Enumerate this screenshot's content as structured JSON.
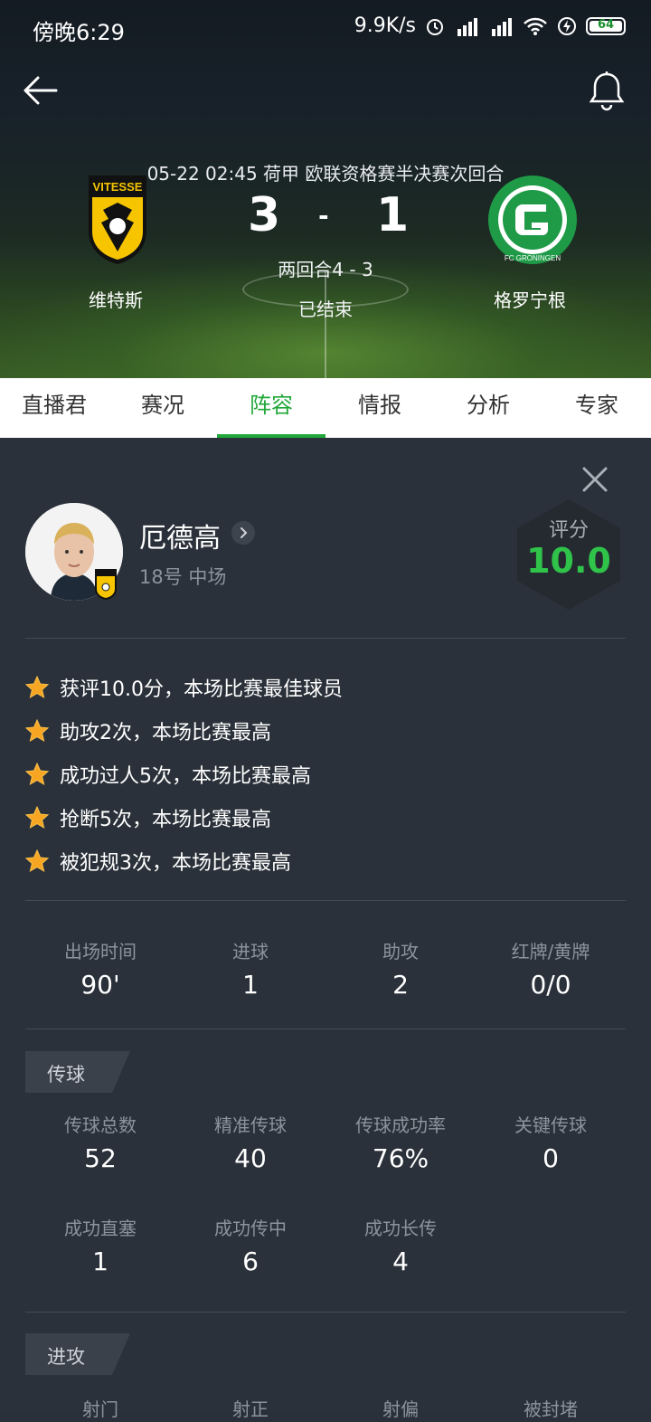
{
  "status_bar": {
    "time": "傍晚6:29",
    "speed": "9.9K/s",
    "battery": "64"
  },
  "match": {
    "info": "05-22  02:45  荷甲 欧联资格赛半决赛次回合",
    "home_score": "3",
    "separator": "-",
    "away_score": "1",
    "aggregate": "两回合4 - 3",
    "status": "已结束",
    "home_team": "维特斯",
    "away_team": "格罗宁根",
    "home_crest_text": "VITESSE",
    "away_crest_text": "FC GRONINGEN"
  },
  "tabs": [
    {
      "label": "直播君"
    },
    {
      "label": "赛况"
    },
    {
      "label": "阵容"
    },
    {
      "label": "情报"
    },
    {
      "label": "分析"
    },
    {
      "label": "专家"
    }
  ],
  "player": {
    "name": "厄德高",
    "meta": "18号 中场",
    "rating_label": "评分",
    "rating": "10.0"
  },
  "highlights": [
    "获评10.0分，本场比赛最佳球员",
    "助攻2次，本场比赛最高",
    "成功过人5次，本场比赛最高",
    "抢断5次，本场比赛最高",
    "被犯规3次，本场比赛最高"
  ],
  "summary": [
    {
      "label": "出场时间",
      "value": "90'"
    },
    {
      "label": "进球",
      "value": "1"
    },
    {
      "label": "助攻",
      "value": "2"
    },
    {
      "label": "红牌/黄牌",
      "value": "0/0"
    }
  ],
  "passing": {
    "title": "传球",
    "stats": [
      {
        "label": "传球总数",
        "value": "52"
      },
      {
        "label": "精准传球",
        "value": "40"
      },
      {
        "label": "传球成功率",
        "value": "76%"
      },
      {
        "label": "关键传球",
        "value": "0"
      },
      {
        "label": "成功直塞",
        "value": "1"
      },
      {
        "label": "成功传中",
        "value": "6"
      },
      {
        "label": "成功长传",
        "value": "4"
      }
    ]
  },
  "attack": {
    "title": "进攻",
    "stats": [
      {
        "label": "射门"
      },
      {
        "label": "射正"
      },
      {
        "label": "射偏"
      },
      {
        "label": "被封堵"
      }
    ]
  },
  "colors": {
    "accent": "#22a83a",
    "rating": "#2fc34a",
    "panel": "#2b313a"
  }
}
